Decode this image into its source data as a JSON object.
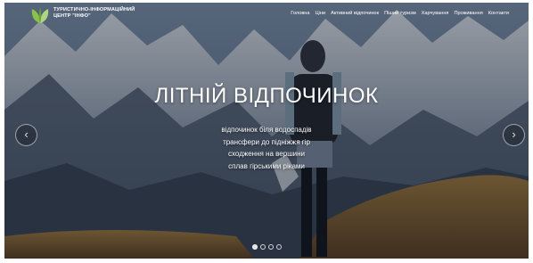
{
  "brand": {
    "line1": "ТУРИСТИЧНО-ІНФОРМАЦІЙНИЙ",
    "line2": "ЦЕНТР \"ІНФО\"",
    "logo_icon": "leaves-logo-icon",
    "logo_color": "#8bc34a"
  },
  "nav": {
    "items": [
      "Головна",
      "Ціни",
      "Активний відпочинок",
      "Піший туризм",
      "Харчування",
      "Проживання",
      "Контакти"
    ]
  },
  "hero": {
    "title": "ЛІТНІЙ ВІДПОЧИНОК",
    "lines": [
      "відпочинок біля водоспадів",
      "трансфери до підніжжя гір",
      "сходження на вершини",
      "сплав гірськими ріками"
    ]
  },
  "carousel": {
    "prev_icon": "chevron-left-icon",
    "next_icon": "chevron-right-icon",
    "slide_count": 4,
    "active_index": 0
  }
}
